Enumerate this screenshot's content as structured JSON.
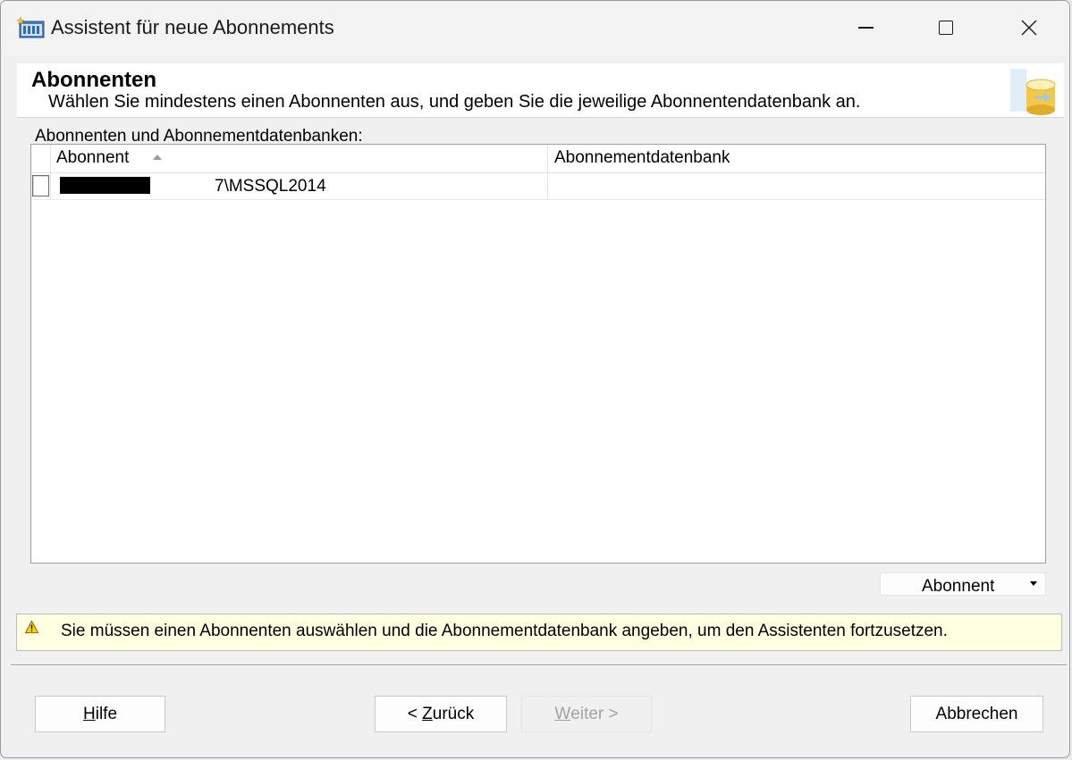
{
  "window": {
    "title": "Assistent für neue Abonnements"
  },
  "header": {
    "title": "Abonnenten",
    "description": "Wählen Sie mindestens einen Abonnenten aus, und geben Sie die jeweilige Abonnentendatenbank an."
  },
  "list": {
    "label": "Abonnenten und Abonnementdatenbanken:",
    "columns": [
      "Abonnent",
      "Abonnementdatenbank"
    ],
    "sort_column": "Abonnent",
    "sort_direction": "ascending",
    "rows": [
      {
        "subscriber_suffix": "7\\MSSQL2014",
        "subscriber_redacted": true,
        "database": "",
        "checked": false
      }
    ]
  },
  "add_button": {
    "label": "Abonnent"
  },
  "warning": {
    "text": "Sie müssen einen Abonnenten auswählen und die Abonnementdatenbank angeben, um den Assistenten fortzusetzen."
  },
  "buttons": {
    "help": {
      "mnemonic": "H",
      "rest": "ilfe"
    },
    "back": {
      "prefix": "< ",
      "mnemonic": "Z",
      "rest": "urück"
    },
    "next": {
      "mnemonic": "W",
      "rest": "eiter >",
      "enabled": false
    },
    "cancel": {
      "label": "Abbrechen"
    }
  },
  "icons": {
    "app": "wizard-app-icon",
    "header": "database-icon",
    "warning": "warning-icon",
    "sort": "sort-ascending-icon",
    "dropdown": "dropdown-arrow-icon"
  },
  "colors": {
    "warning_background": "#ffffe1",
    "window_background": "#f0f0f0",
    "header_background": "#ffffff"
  }
}
